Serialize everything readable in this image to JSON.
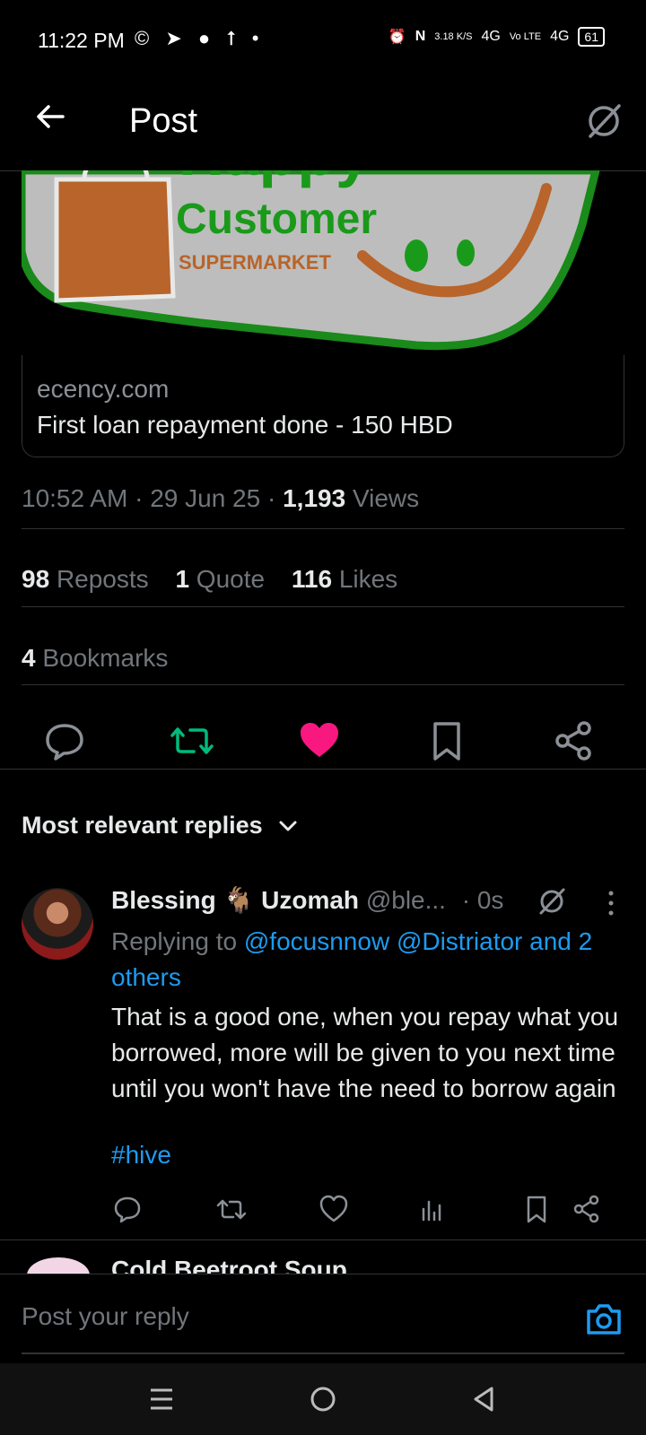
{
  "status_bar": {
    "time": "11:22 PM",
    "app_icons": "© ➤ ● ⭡ •",
    "speed": "3.18 K/S",
    "network1": "4G",
    "volte": "Vo LTE",
    "network2": "4G",
    "battery": "61"
  },
  "header": {
    "title": "Post"
  },
  "logo": {
    "line1": "Happy",
    "line2": "Customer",
    "line3": "SUPERMARKET"
  },
  "link_card": {
    "domain": "ecency.com",
    "title": "First loan repayment done - 150 HBD"
  },
  "post_meta": {
    "time": "10:52 AM",
    "date": "29 Jun 25",
    "views_count": "1,193",
    "views_label": "Views"
  },
  "stats": {
    "reposts_count": "98",
    "reposts_label": "Reposts",
    "quotes_count": "1",
    "quotes_label": "Quote",
    "likes_count": "116",
    "likes_label": "Likes",
    "bookmarks_count": "4",
    "bookmarks_label": "Bookmarks"
  },
  "replies_sort": {
    "label": "Most relevant replies"
  },
  "reply": {
    "name_first": "Blessing",
    "name_emoji": "🐐",
    "name_last": "Uzomah",
    "handle": "@ble...",
    "time": "· 0s",
    "replying_prefix": "Replying to",
    "replying_users": "@focusnnow @Distriator and 2 others",
    "text": "That is a good one, when you repay what you borrowed, more will be given to you next time until you won't have the need to borrow again",
    "hashtag": "#hive"
  },
  "next_reply": {
    "name": "Cold Beetroot Soup"
  },
  "composer": {
    "placeholder": "Post your reply"
  },
  "colors": {
    "accent": "#1d9bf0",
    "like": "#f91880",
    "repost": "#00ba7c",
    "background": "#000000"
  }
}
